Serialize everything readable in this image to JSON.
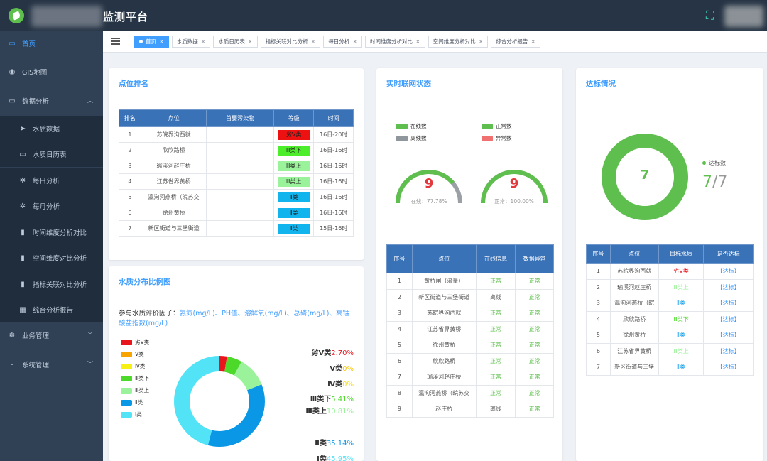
{
  "header": {
    "title": "监测平台"
  },
  "sidebar": {
    "items": [
      {
        "label": "首页",
        "icon": "monitor-icon",
        "glyph": "▭"
      },
      {
        "label": "GIS地图",
        "icon": "eye-icon",
        "glyph": "◉"
      },
      {
        "label": "数据分析",
        "icon": "monitor-icon",
        "glyph": "▭",
        "caret": "︿"
      },
      {
        "label": "水质数据",
        "icon": "send-icon",
        "glyph": "➤"
      },
      {
        "label": "水质日历表",
        "icon": "monitor-icon",
        "glyph": "▭"
      },
      {
        "label": "每日分析",
        "icon": "gear-icon",
        "glyph": "✲"
      },
      {
        "label": "每月分析",
        "icon": "gear-icon",
        "glyph": "✲"
      },
      {
        "label": "时间维度分析对比",
        "icon": "bar-chart-icon",
        "glyph": "▮"
      },
      {
        "label": "空间维度对比分析",
        "icon": "bar-chart-icon",
        "glyph": "▮"
      },
      {
        "label": "指标关联对比分析",
        "icon": "bar-chart-icon",
        "glyph": "▮"
      },
      {
        "label": "综合分析报告",
        "icon": "grid-icon",
        "glyph": "▦"
      },
      {
        "label": "业务管理",
        "icon": "gear-icon",
        "glyph": "✲",
        "caret": "﹀"
      },
      {
        "label": "系统管理",
        "icon": "dash-icon",
        "glyph": "–",
        "caret": "﹀"
      }
    ]
  },
  "tabs": [
    "首页",
    "水质数据",
    "水质日历表",
    "指标关联对比分析",
    "每日分析",
    "时间维度分析对比",
    "空间维度分析对比",
    "综合分析报告"
  ],
  "ranking": {
    "title": "点位排名",
    "headers": [
      "排名",
      "点位",
      "首要污染物",
      "等级",
      "时间"
    ],
    "rows": [
      {
        "rank": "1",
        "site": "苏皖界泃西就",
        "pollutant": "",
        "grade": "劣Ⅴ类",
        "grade_color": "#ee1111",
        "time": "16日-20时"
      },
      {
        "rank": "2",
        "site": "欣欣路桥",
        "pollutant": "",
        "grade": "Ⅲ类下",
        "grade_color": "#4cee2c",
        "time": "16日-16时"
      },
      {
        "rank": "3",
        "site": "瑜溪河赵庄桥",
        "pollutant": "",
        "grade": "Ⅲ类上",
        "grade_color": "#9af29a",
        "time": "16日-16时"
      },
      {
        "rank": "4",
        "site": "江苏省界黄桥",
        "pollutant": "",
        "grade": "Ⅲ类上",
        "grade_color": "#9af29a",
        "time": "16日-16时"
      },
      {
        "rank": "5",
        "site": "瀛洵河燕桥（皖苏交",
        "pollutant": "",
        "grade": "Ⅱ类",
        "grade_color": "#12b4ee",
        "time": "16日-16时"
      },
      {
        "rank": "6",
        "site": "徐州黄桥",
        "pollutant": "",
        "grade": "Ⅱ类",
        "grade_color": "#12b4ee",
        "time": "16日-16时"
      },
      {
        "rank": "7",
        "site": "新区街道与三堡街道",
        "pollutant": "",
        "grade": "Ⅱ类",
        "grade_color": "#12b4ee",
        "time": "15日-16时"
      }
    ]
  },
  "distribution": {
    "title": "水质分布比例图",
    "factor_prefix": "参与水质评价因子：",
    "factor_list": "氨氮(mg/L)、PH值、溶解氧(mg/L)、总磷(mg/L)、高锰酸盐指数(mg/L)",
    "legend": [
      {
        "label": "劣Ⅴ类",
        "color": "#e8161c"
      },
      {
        "label": "Ⅴ类",
        "color": "#f7a400"
      },
      {
        "label": "Ⅳ类",
        "color": "#f6f014"
      },
      {
        "label": "Ⅲ类下",
        "color": "#4cd92a"
      },
      {
        "label": "Ⅲ类上",
        "color": "#9af29a"
      },
      {
        "label": "Ⅱ类",
        "color": "#0a98e6"
      },
      {
        "label": "Ⅰ类",
        "color": "#52e3f7"
      }
    ],
    "ratios": [
      {
        "label": "劣Ⅴ类",
        "pct": "2.70%",
        "color": "#e8161c"
      },
      {
        "label": "Ⅴ类",
        "pct": "0%",
        "color": "#f7c600"
      },
      {
        "label": "Ⅳ类",
        "pct": "0%",
        "color": "#f6e014"
      },
      {
        "label": "Ⅲ类下",
        "pct": "5.41%",
        "color": "#4cd92a"
      },
      {
        "label": "Ⅲ类上",
        "pct": "10.81%",
        "color": "#9af29a"
      },
      {
        "label": "Ⅱ类",
        "pct": "35.14%",
        "color": "#0a98e6"
      },
      {
        "label": "Ⅰ类",
        "pct": "45.95%",
        "color": "#52e3f7"
      }
    ]
  },
  "chart_data": {
    "type": "pie",
    "categories": [
      "劣Ⅴ类",
      "Ⅴ类",
      "Ⅳ类",
      "Ⅲ类下",
      "Ⅲ类上",
      "Ⅱ类",
      "Ⅰ类"
    ],
    "values": [
      2.7,
      0,
      0,
      5.41,
      10.81,
      35.14,
      45.95
    ],
    "colors": [
      "#e8161c",
      "#f7a400",
      "#f6f014",
      "#4cd92a",
      "#9af29a",
      "#0a98e6",
      "#52e3f7"
    ],
    "title": "",
    "donut": true
  },
  "realtime": {
    "title": "实时联网状态",
    "legend": [
      {
        "label": "在线数",
        "color": "#5fbf4e"
      },
      {
        "label": "正常数",
        "color": "#5fbf4e"
      },
      {
        "label": "离线数",
        "color": "#8f969c"
      },
      {
        "label": "异常数",
        "color": "#f06f6f"
      }
    ],
    "gauges": [
      {
        "value": "9",
        "fraction": 0.7778,
        "sub": "在线：77.78%",
        "fill": "#5fbf4e",
        "track": "#9aa0a6"
      },
      {
        "value": "9",
        "fraction": 1.0,
        "sub": "正常：100.00%",
        "fill": "#5fbf4e",
        "track": "#9aa0a6"
      }
    ],
    "headers": [
      "序号",
      "点位",
      "在线信息",
      "数据异常"
    ],
    "rows": [
      {
        "no": "1",
        "site": "黄桥闸（流量）",
        "online": "正常",
        "online_ok": true,
        "data": "正常"
      },
      {
        "no": "2",
        "site": "新区街道与三堡街道",
        "online": "离线",
        "online_ok": false,
        "data": "正常"
      },
      {
        "no": "3",
        "site": "苏皖界泃西就",
        "online": "正常",
        "online_ok": true,
        "data": "正常"
      },
      {
        "no": "4",
        "site": "江苏省界黄桥",
        "online": "正常",
        "online_ok": true,
        "data": "正常"
      },
      {
        "no": "5",
        "site": "徐州黄桥",
        "online": "正常",
        "online_ok": true,
        "data": "正常"
      },
      {
        "no": "6",
        "site": "欣欣路桥",
        "online": "正常",
        "online_ok": true,
        "data": "正常"
      },
      {
        "no": "7",
        "site": "瑜溪河赵庄桥",
        "online": "正常",
        "online_ok": true,
        "data": "正常"
      },
      {
        "no": "8",
        "site": "瀛洵河燕桥（皖苏交",
        "online": "正常",
        "online_ok": true,
        "data": "正常"
      },
      {
        "no": "9",
        "site": "赵庄桥",
        "online": "离线",
        "online_ok": false,
        "data": "正常"
      }
    ]
  },
  "compliance": {
    "title": "达标情况",
    "center_value": "7",
    "legend_label": "达标数",
    "count": "7",
    "total": "/7",
    "fraction": 1.0,
    "ring_color": "#5fbf4e",
    "headers": [
      "序号",
      "点位",
      "目标水质",
      "是否达标"
    ],
    "rows": [
      {
        "no": "1",
        "site": "苏皖界泃西就",
        "target": "劣Ⅴ类",
        "target_color": "#e8161c",
        "status": "【达标】"
      },
      {
        "no": "2",
        "site": "瑜溪河赵庄桥",
        "target": "Ⅲ类上",
        "target_color": "#9af29a",
        "status": "【达标】"
      },
      {
        "no": "3",
        "site": "瀛洵河燕桥（皖",
        "target": "Ⅱ类",
        "target_color": "#0a98e6",
        "status": "【达标】"
      },
      {
        "no": "4",
        "site": "欣欣路桥",
        "target": "Ⅲ类下",
        "target_color": "#4cd92a",
        "status": "【达标】"
      },
      {
        "no": "5",
        "site": "徐州黄桥",
        "target": "Ⅱ类",
        "target_color": "#0a98e6",
        "status": "【达标】"
      },
      {
        "no": "6",
        "site": "江苏省界黄桥",
        "target": "Ⅲ类上",
        "target_color": "#9af29a",
        "status": "【达标】"
      },
      {
        "no": "7",
        "site": "新区街道与三堡",
        "target": "Ⅱ类",
        "target_color": "#0a98e6",
        "status": "【达标】"
      }
    ]
  }
}
